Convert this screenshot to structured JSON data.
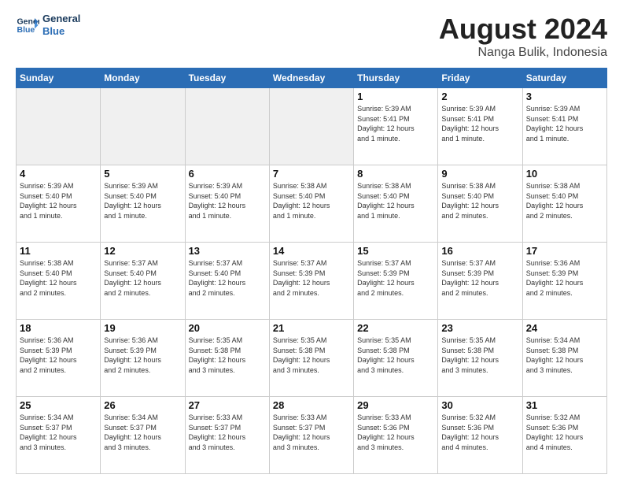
{
  "header": {
    "logo_line1": "General",
    "logo_line2": "Blue",
    "month": "August 2024",
    "location": "Nanga Bulik, Indonesia"
  },
  "weekdays": [
    "Sunday",
    "Monday",
    "Tuesday",
    "Wednesday",
    "Thursday",
    "Friday",
    "Saturday"
  ],
  "weeks": [
    [
      {
        "day": "",
        "info": ""
      },
      {
        "day": "",
        "info": ""
      },
      {
        "day": "",
        "info": ""
      },
      {
        "day": "",
        "info": ""
      },
      {
        "day": "1",
        "info": "Sunrise: 5:39 AM\nSunset: 5:41 PM\nDaylight: 12 hours\nand 1 minute."
      },
      {
        "day": "2",
        "info": "Sunrise: 5:39 AM\nSunset: 5:41 PM\nDaylight: 12 hours\nand 1 minute."
      },
      {
        "day": "3",
        "info": "Sunrise: 5:39 AM\nSunset: 5:41 PM\nDaylight: 12 hours\nand 1 minute."
      }
    ],
    [
      {
        "day": "4",
        "info": "Sunrise: 5:39 AM\nSunset: 5:40 PM\nDaylight: 12 hours\nand 1 minute."
      },
      {
        "day": "5",
        "info": "Sunrise: 5:39 AM\nSunset: 5:40 PM\nDaylight: 12 hours\nand 1 minute."
      },
      {
        "day": "6",
        "info": "Sunrise: 5:39 AM\nSunset: 5:40 PM\nDaylight: 12 hours\nand 1 minute."
      },
      {
        "day": "7",
        "info": "Sunrise: 5:38 AM\nSunset: 5:40 PM\nDaylight: 12 hours\nand 1 minute."
      },
      {
        "day": "8",
        "info": "Sunrise: 5:38 AM\nSunset: 5:40 PM\nDaylight: 12 hours\nand 1 minute."
      },
      {
        "day": "9",
        "info": "Sunrise: 5:38 AM\nSunset: 5:40 PM\nDaylight: 12 hours\nand 2 minutes."
      },
      {
        "day": "10",
        "info": "Sunrise: 5:38 AM\nSunset: 5:40 PM\nDaylight: 12 hours\nand 2 minutes."
      }
    ],
    [
      {
        "day": "11",
        "info": "Sunrise: 5:38 AM\nSunset: 5:40 PM\nDaylight: 12 hours\nand 2 minutes."
      },
      {
        "day": "12",
        "info": "Sunrise: 5:37 AM\nSunset: 5:40 PM\nDaylight: 12 hours\nand 2 minutes."
      },
      {
        "day": "13",
        "info": "Sunrise: 5:37 AM\nSunset: 5:40 PM\nDaylight: 12 hours\nand 2 minutes."
      },
      {
        "day": "14",
        "info": "Sunrise: 5:37 AM\nSunset: 5:39 PM\nDaylight: 12 hours\nand 2 minutes."
      },
      {
        "day": "15",
        "info": "Sunrise: 5:37 AM\nSunset: 5:39 PM\nDaylight: 12 hours\nand 2 minutes."
      },
      {
        "day": "16",
        "info": "Sunrise: 5:37 AM\nSunset: 5:39 PM\nDaylight: 12 hours\nand 2 minutes."
      },
      {
        "day": "17",
        "info": "Sunrise: 5:36 AM\nSunset: 5:39 PM\nDaylight: 12 hours\nand 2 minutes."
      }
    ],
    [
      {
        "day": "18",
        "info": "Sunrise: 5:36 AM\nSunset: 5:39 PM\nDaylight: 12 hours\nand 2 minutes."
      },
      {
        "day": "19",
        "info": "Sunrise: 5:36 AM\nSunset: 5:39 PM\nDaylight: 12 hours\nand 2 minutes."
      },
      {
        "day": "20",
        "info": "Sunrise: 5:35 AM\nSunset: 5:38 PM\nDaylight: 12 hours\nand 3 minutes."
      },
      {
        "day": "21",
        "info": "Sunrise: 5:35 AM\nSunset: 5:38 PM\nDaylight: 12 hours\nand 3 minutes."
      },
      {
        "day": "22",
        "info": "Sunrise: 5:35 AM\nSunset: 5:38 PM\nDaylight: 12 hours\nand 3 minutes."
      },
      {
        "day": "23",
        "info": "Sunrise: 5:35 AM\nSunset: 5:38 PM\nDaylight: 12 hours\nand 3 minutes."
      },
      {
        "day": "24",
        "info": "Sunrise: 5:34 AM\nSunset: 5:38 PM\nDaylight: 12 hours\nand 3 minutes."
      }
    ],
    [
      {
        "day": "25",
        "info": "Sunrise: 5:34 AM\nSunset: 5:37 PM\nDaylight: 12 hours\nand 3 minutes."
      },
      {
        "day": "26",
        "info": "Sunrise: 5:34 AM\nSunset: 5:37 PM\nDaylight: 12 hours\nand 3 minutes."
      },
      {
        "day": "27",
        "info": "Sunrise: 5:33 AM\nSunset: 5:37 PM\nDaylight: 12 hours\nand 3 minutes."
      },
      {
        "day": "28",
        "info": "Sunrise: 5:33 AM\nSunset: 5:37 PM\nDaylight: 12 hours\nand 3 minutes."
      },
      {
        "day": "29",
        "info": "Sunrise: 5:33 AM\nSunset: 5:36 PM\nDaylight: 12 hours\nand 3 minutes."
      },
      {
        "day": "30",
        "info": "Sunrise: 5:32 AM\nSunset: 5:36 PM\nDaylight: 12 hours\nand 4 minutes."
      },
      {
        "day": "31",
        "info": "Sunrise: 5:32 AM\nSunset: 5:36 PM\nDaylight: 12 hours\nand 4 minutes."
      }
    ]
  ]
}
